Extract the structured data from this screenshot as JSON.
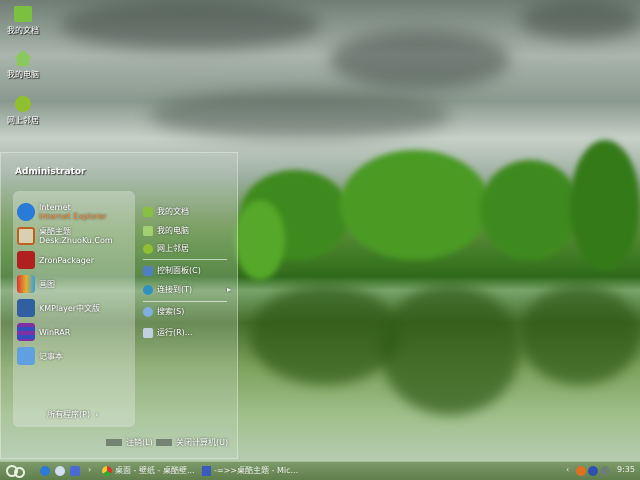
{
  "desktop": {
    "icons": [
      {
        "label": "我的文档",
        "icon": "folder-icon"
      },
      {
        "label": "我的电脑",
        "icon": "home-icon"
      },
      {
        "label": "网上邻居",
        "icon": "globe-icon"
      }
    ]
  },
  "start_menu": {
    "user": "Administrator",
    "pinned": [
      {
        "title": "Internet",
        "subtitle": "Internet Explorer",
        "icon": "ie-icon",
        "color": "#2a7ad8"
      },
      {
        "title": "桌酷主题",
        "subtitle": "Desk.ZhuoKu.Com",
        "icon": "theme-icon",
        "color": "#d8d0b0"
      },
      {
        "title": "ZronPackager",
        "icon": "package-icon",
        "color": "#b02020"
      },
      {
        "title": "画图",
        "icon": "paint-icon",
        "color": "#e0b030"
      },
      {
        "title": "KMPlayer中文版",
        "icon": "kmplayer-icon",
        "color": "#3060a0"
      },
      {
        "title": "WinRAR",
        "icon": "winrar-icon",
        "color": "#8030a0"
      },
      {
        "title": "记事本",
        "icon": "notepad-icon",
        "color": "#60a0e0"
      }
    ],
    "all_programs": "所有程序(P)",
    "places": [
      {
        "label": "我的文档",
        "icon": "folder-icon",
        "color": "#8ac040"
      },
      {
        "label": "我的电脑",
        "icon": "home-icon",
        "color": "#a0d070"
      },
      {
        "label": "网上邻居",
        "icon": "globe-icon",
        "color": "#90c030"
      },
      {
        "label": "控制面板(C)",
        "icon": "control-panel-icon",
        "color": "#5080c0"
      },
      {
        "label": "连接到(T)",
        "icon": "connect-icon",
        "color": "#3090c0"
      },
      {
        "label": "搜索(S)",
        "icon": "search-icon",
        "color": "#80b0e0"
      },
      {
        "label": "运行(R)...",
        "icon": "run-icon",
        "color": "#c0d0e0"
      }
    ],
    "logoff": "注销(L)",
    "shutdown": "关闭计算机(U)"
  },
  "taskbar": {
    "tasks": [
      {
        "label": "桌面 - 壁纸 - 桌酷壁...",
        "icon": "chrome-icon"
      },
      {
        "label": "-=>>桌酷主题 - Mic...",
        "icon": "word-icon"
      }
    ],
    "clock": "9:35"
  }
}
